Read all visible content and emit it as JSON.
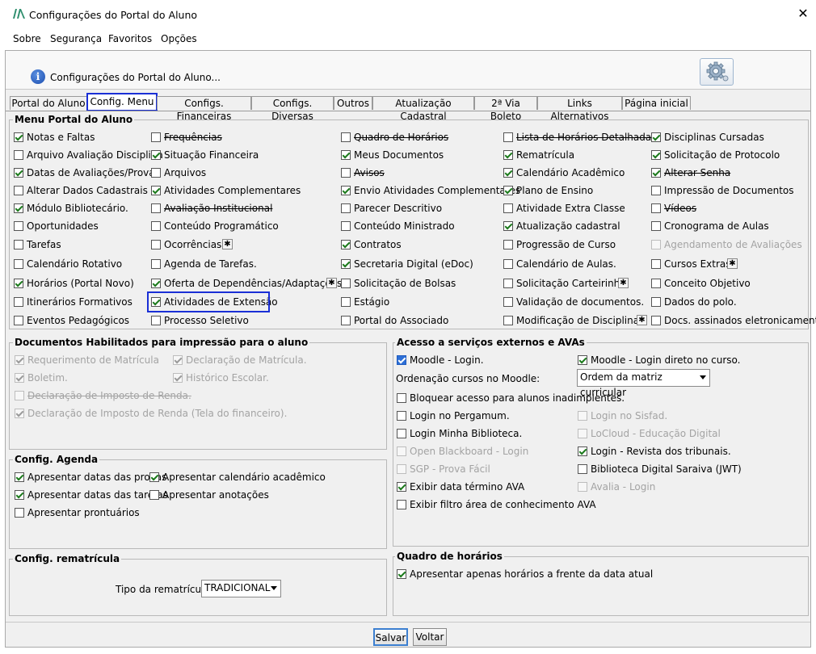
{
  "window": {
    "title": "Configurações do Portal do Aluno",
    "close_glyph": "✕",
    "logo_icon": "portal-logo-icon"
  },
  "menubar": [
    "Sobre",
    "Segurança",
    "Favoritos",
    "Opções"
  ],
  "header": {
    "text": "Configurações do Portal do Aluno...",
    "info_icon": "i"
  },
  "tabs": [
    "Portal do Aluno",
    "Config. Menu",
    "Configs. Financeiras",
    "Configs. Diversas",
    "Outros",
    "Atualização Cadastral",
    "2ª Via Boleto",
    "Links Alternativos",
    "Página inicial"
  ],
  "active_tab": "Config. Menu",
  "menu_portal": {
    "title": "Menu Portal do Aluno",
    "columns": [
      [
        {
          "label": "Notas e Faltas",
          "checked": true
        },
        {
          "label": "Arquivo Avaliação Disciplina",
          "checked": false
        },
        {
          "label": "Datas de Avaliações/Provas",
          "checked": true
        },
        {
          "label": "Alterar Dados Cadastrais",
          "checked": false
        },
        {
          "label": "Módulo Bibliotecário.",
          "checked": true
        },
        {
          "label": "Oportunidades",
          "checked": false
        },
        {
          "label": "Tarefas",
          "checked": false
        },
        {
          "label": "Calendário Rotativo",
          "checked": false
        },
        {
          "label": "Horários (Portal Novo)",
          "checked": true
        },
        {
          "label": "Itinerários Formativos",
          "checked": false
        },
        {
          "label": "Eventos Pedagógicos",
          "checked": false
        }
      ],
      [
        {
          "label": "Frequências",
          "checked": false,
          "strike": true
        },
        {
          "label": "Situação Financeira",
          "checked": true
        },
        {
          "label": "Arquivos",
          "checked": false
        },
        {
          "label": "Atividades Complementares",
          "checked": true
        },
        {
          "label": "Avaliação Institucional",
          "checked": false,
          "strike": true
        },
        {
          "label": "Conteúdo Programático",
          "checked": false
        },
        {
          "label": "Ocorrências",
          "checked": false,
          "gear": true
        },
        {
          "label": "Agenda de Tarefas.",
          "checked": false
        },
        {
          "label": "Oferta de Dependências/Adaptações",
          "checked": true,
          "gear": true
        },
        {
          "label": "Atividades de Extensão",
          "checked": true,
          "highlight": true
        },
        {
          "label": "Processo Seletivo",
          "checked": false
        }
      ],
      [
        {
          "label": "Quadro de Horários",
          "checked": false,
          "strike": true
        },
        {
          "label": "Meus Documentos",
          "checked": true
        },
        {
          "label": "Avisos",
          "checked": false,
          "strike": true
        },
        {
          "label": "Envio Atividades Complementares",
          "checked": true
        },
        {
          "label": "Parecer Descritivo",
          "checked": false
        },
        {
          "label": "Conteúdo Ministrado",
          "checked": false
        },
        {
          "label": "Contratos",
          "checked": true
        },
        {
          "label": "Secretaria Digital (eDoc)",
          "checked": true
        },
        {
          "label": "Solicitação de Bolsas",
          "checked": false
        },
        {
          "label": "Estágio",
          "checked": false
        },
        {
          "label": "Portal do Associado",
          "checked": false
        }
      ],
      [
        {
          "label": "Lista de Horários Detalhada",
          "checked": false,
          "strike": true
        },
        {
          "label": "Rematrícula",
          "checked": true
        },
        {
          "label": "Calendário Acadêmico",
          "checked": true
        },
        {
          "label": "Plano de Ensino",
          "checked": true
        },
        {
          "label": "Atividade Extra Classe",
          "checked": false
        },
        {
          "label": "Atualização cadastral",
          "checked": true
        },
        {
          "label": "Progressão de Curso",
          "checked": false
        },
        {
          "label": "Calendário de Aulas.",
          "checked": false
        },
        {
          "label": "Solicitação Carteirinha",
          "checked": false,
          "gear": true
        },
        {
          "label": "Validação de documentos.",
          "checked": false
        },
        {
          "label": "Modificação de Disciplinas",
          "checked": false,
          "gear": true
        }
      ],
      [
        {
          "label": "Disciplinas Cursadas",
          "checked": true
        },
        {
          "label": "Solicitação de Protocolo",
          "checked": true
        },
        {
          "label": "Alterar Senha",
          "checked": true,
          "strike": true
        },
        {
          "label": "Impressão de Documentos",
          "checked": false
        },
        {
          "label": "Vídeos",
          "checked": false,
          "strike": true
        },
        {
          "label": "Cronograma de Aulas",
          "checked": false
        },
        {
          "label": "Agendamento de Avaliações",
          "checked": false,
          "disabled": true
        },
        {
          "label": "Cursos Extras",
          "checked": false,
          "gear": true
        },
        {
          "label": "Conceito Objetivo",
          "checked": false
        },
        {
          "label": "Dados do polo.",
          "checked": false
        },
        {
          "label": "Docs. assinados eletronicamente.",
          "checked": false
        }
      ]
    ]
  },
  "documentos": {
    "title": "Documentos Habilitados para impressão para o aluno",
    "items": [
      {
        "label": "Requerimento de Matrícula",
        "checked": true
      },
      {
        "label": "Declaração de Matrícula.",
        "checked": true
      },
      {
        "label": "Boletim.",
        "checked": true
      },
      {
        "label": "Histórico Escolar.",
        "checked": true
      },
      {
        "label": "Declaração de Imposto de Renda.",
        "checked": false,
        "strike": true
      },
      {
        "label": "Declaração de Imposto de Renda (Tela do financeiro).",
        "checked": true
      }
    ]
  },
  "agenda": {
    "title": "Config. Agenda",
    "items": [
      {
        "label": "Apresentar datas das provas",
        "checked": true
      },
      {
        "label": "Apresentar calendário acadêmico",
        "checked": true
      },
      {
        "label": "Apresentar datas das tarefas",
        "checked": true
      },
      {
        "label": "Apresentar anotações",
        "checked": false
      },
      {
        "label": "Apresentar prontuários",
        "checked": false
      }
    ]
  },
  "rematricula": {
    "title": "Config. rematrícula",
    "label": "Tipo da rematrícula:",
    "value": "TRADICIONAL"
  },
  "acesso": {
    "title": "Acesso a serviços externos e AVAs",
    "moodle_login": {
      "label": "Moodle - Login.",
      "checked": true
    },
    "moodle_direto": {
      "label": "Moodle - Login direto no curso.",
      "checked": true
    },
    "ordenacao_label": "Ordenação cursos no Moodle:",
    "ordenacao_value": "Ordem da matriz curricular",
    "bloquear": {
      "label": "Bloquear acesso para alunos inadimplentes.",
      "checked": false
    },
    "left": [
      {
        "label": "Login no Pergamum.",
        "checked": false
      },
      {
        "label": "Login Minha Biblioteca.",
        "checked": false
      },
      {
        "label": "Open Blackboard - Login",
        "checked": false,
        "disabled": true
      },
      {
        "label": "SGP - Prova Fácil",
        "checked": false,
        "disabled": true
      },
      {
        "label": "Exibir data término AVA",
        "checked": true
      },
      {
        "label": "Exibir filtro área de conhecimento AVA",
        "checked": false
      }
    ],
    "right": [
      {
        "label": "Login no Sisfad.",
        "checked": false,
        "disabled": true
      },
      {
        "label": "LoCloud - Educação Digital",
        "checked": false,
        "disabled": true
      },
      {
        "label": "Login - Revista dos tribunais.",
        "checked": true
      },
      {
        "label": "Biblioteca Digital Saraiva (JWT)",
        "checked": false
      },
      {
        "label": "Avalia - Login",
        "checked": false,
        "disabled": true
      }
    ]
  },
  "quadro": {
    "title": "Quadro de horários",
    "item": {
      "label": "Apresentar apenas horários a frente da data atual",
      "checked": true
    }
  },
  "footer": {
    "save": "Salvar",
    "back": "Voltar"
  }
}
